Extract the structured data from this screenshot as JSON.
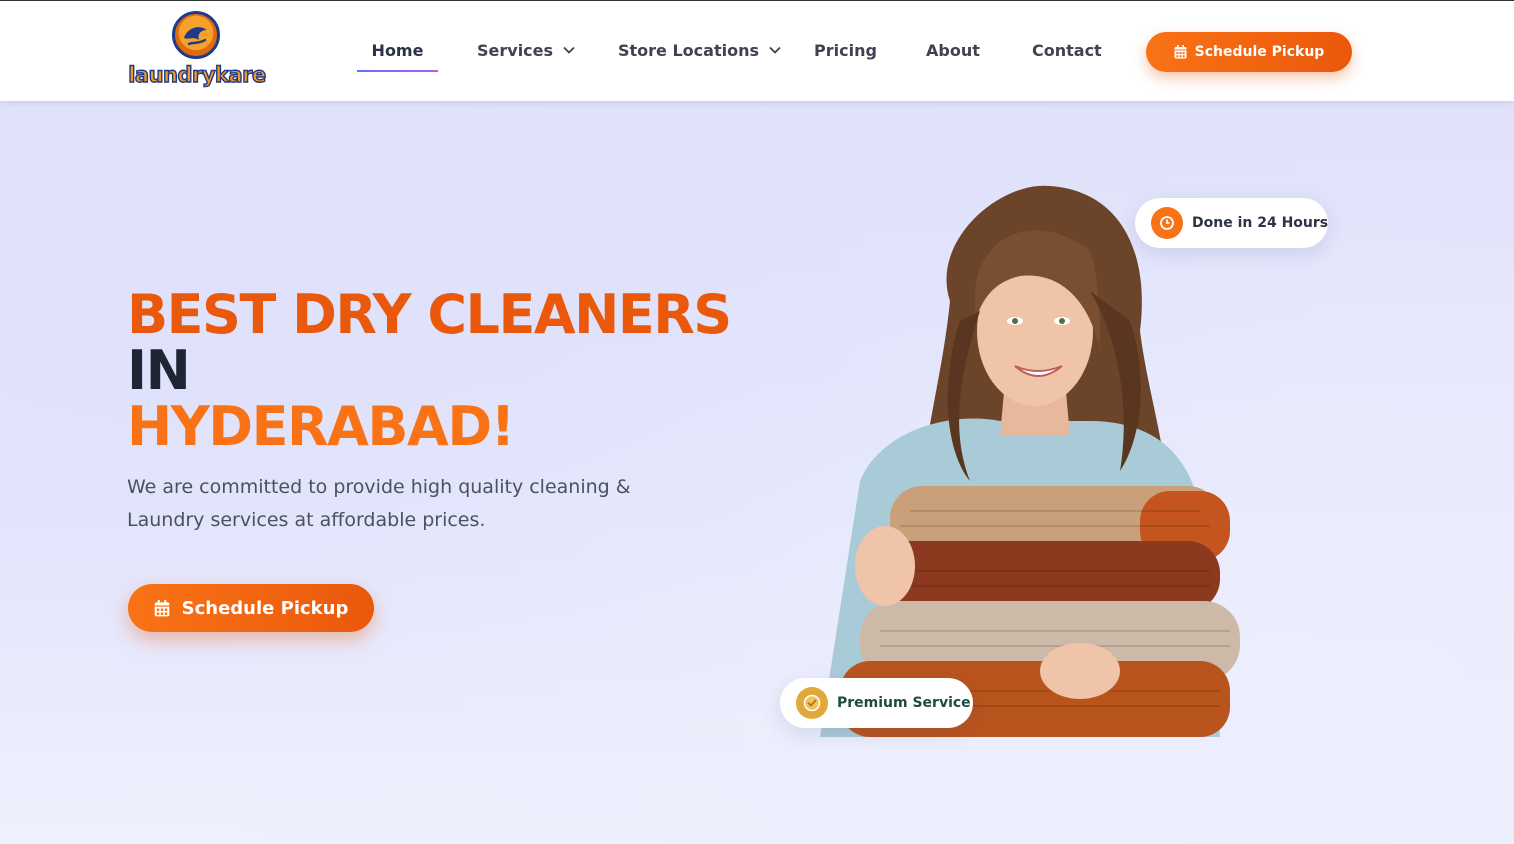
{
  "brand": {
    "logo_text": "laundrykare",
    "colors": {
      "primary": "#f97316",
      "primary_dark": "#ea580c",
      "navy": "#1f3a8a"
    }
  },
  "nav": {
    "items": [
      {
        "label": "Home",
        "active": true,
        "dropdown": false
      },
      {
        "label": "Services",
        "active": false,
        "dropdown": true
      },
      {
        "label": "Store Locations",
        "active": false,
        "dropdown": true
      },
      {
        "label": "Pricing",
        "active": false,
        "dropdown": false
      },
      {
        "label": "About",
        "active": false,
        "dropdown": false
      },
      {
        "label": "Contact",
        "active": false,
        "dropdown": false
      }
    ],
    "cta": {
      "label": "Schedule Pickup",
      "icon": "calendar-icon"
    }
  },
  "hero": {
    "headline_line1": "BEST DRY CLEANERS",
    "headline_line2": "IN",
    "headline_line3": "HYDERABAD!",
    "subtext": "We are committed to provide high quality cleaning & Laundry services at affordable prices.",
    "cta": {
      "label": "Schedule Pickup",
      "icon": "calendar-icon"
    },
    "badges": [
      {
        "label": "Done in 24 Hours",
        "icon": "clock-icon"
      },
      {
        "label": "Premium Service",
        "icon": "check-badge-icon"
      }
    ]
  }
}
